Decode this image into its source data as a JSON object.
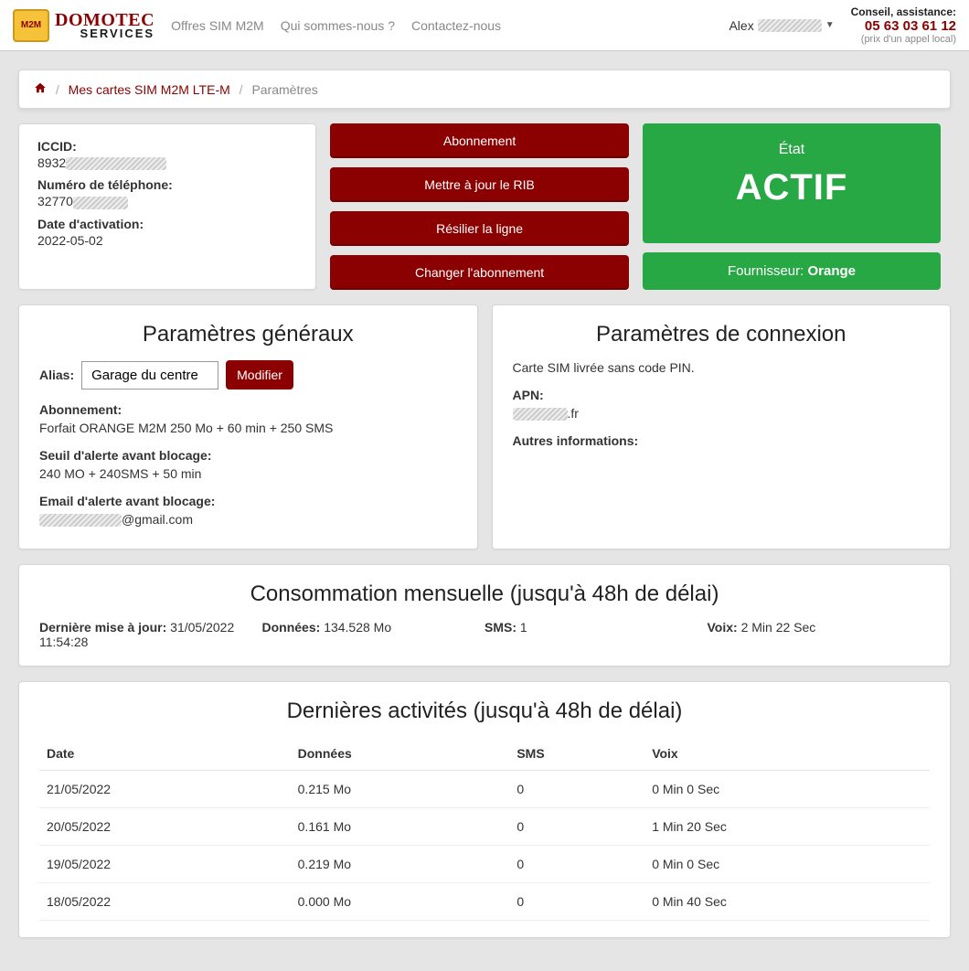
{
  "nav": {
    "logo_chip": "M2M",
    "logo_line1": "DOMOTEC",
    "logo_line2": "SERVICES",
    "links": [
      "Offres SIM M2M",
      "Qui sommes-nous ?",
      "Contactez-nous"
    ],
    "user_prefix": "Alex",
    "assist_label": "Conseil, assistance:",
    "assist_phone": "05 63 03 61 12",
    "assist_sub": "(prix d'un appel local)"
  },
  "breadcrumb": {
    "link": "Mes cartes SIM M2M LTE-M",
    "current": "Paramètres"
  },
  "info": {
    "iccid_label": "ICCID:",
    "iccid_value_prefix": "8932",
    "phone_label": "Numéro de téléphone:",
    "phone_value_prefix": "32770",
    "activation_label": "Date d'activation:",
    "activation_value": "2022-05-02"
  },
  "buttons": {
    "b1": "Abonnement",
    "b2": "Mettre à jour le RIB",
    "b3": "Résilier la ligne",
    "b4": "Changer l'abonnement"
  },
  "status": {
    "etat": "État",
    "actif": "ACTIF",
    "supplier_label": "Fournisseur: ",
    "supplier_value": "Orange"
  },
  "general": {
    "title": "Paramètres généraux",
    "alias_label": "Alias:",
    "alias_value": "Garage du centre",
    "modify": "Modifier",
    "abo_label": "Abonnement:",
    "abo_value": "Forfait ORANGE M2M 250 Mo + 60 min + 250 SMS",
    "seuil_label": "Seuil d'alerte avant blocage:",
    "seuil_value": "240 MO + 240SMS + 50 min",
    "email_label": "Email d'alerte avant blocage:",
    "email_suffix": "@gmail.com"
  },
  "conn": {
    "title": "Paramètres de connexion",
    "pin_text": "Carte SIM livrée sans code PIN.",
    "apn_label": "APN:",
    "apn_suffix": ".fr",
    "other_label": "Autres informations:"
  },
  "conso": {
    "title": "Consommation mensuelle (jusqu'à 48h de délai)",
    "update_label": "Dernière mise à jour: ",
    "update_value": "31/05/2022 11:54:28",
    "data_label": "Données: ",
    "data_value": "134.528 Mo",
    "sms_label": "SMS: ",
    "sms_value": "1",
    "voice_label": "Voix: ",
    "voice_value": "2 Min 22 Sec"
  },
  "activity": {
    "title": "Dernières activités (jusqu'à 48h de délai)",
    "headers": {
      "date": "Date",
      "data": "Données",
      "sms": "SMS",
      "voice": "Voix"
    },
    "rows": [
      {
        "date": "21/05/2022",
        "data": "0.215 Mo",
        "sms": "0",
        "voice": "0 Min 0 Sec"
      },
      {
        "date": "20/05/2022",
        "data": "0.161 Mo",
        "sms": "0",
        "voice": "1 Min 20 Sec"
      },
      {
        "date": "19/05/2022",
        "data": "0.219 Mo",
        "sms": "0",
        "voice": "0 Min 0 Sec"
      },
      {
        "date": "18/05/2022",
        "data": "0.000 Mo",
        "sms": "0",
        "voice": "0 Min 40 Sec"
      }
    ]
  }
}
